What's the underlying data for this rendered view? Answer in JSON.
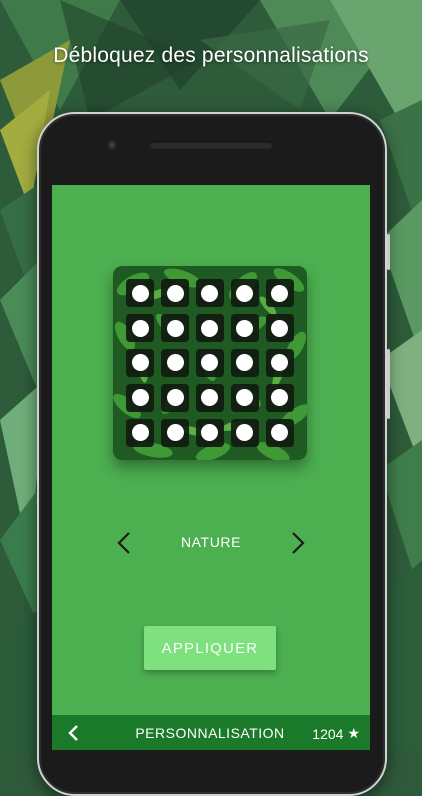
{
  "headline": "Débloquez des personnalisations",
  "customization": {
    "theme_name": "NATURE",
    "apply_label": "APPLIQUER",
    "grid": {
      "rows": 5,
      "cols": 5
    }
  },
  "bottom_bar": {
    "title": "PERSONNALISATION",
    "star_count": "1204",
    "star_icon": "★"
  },
  "colors": {
    "screen_bg": "#4caf50",
    "button_bg": "#7ee07f",
    "bottom_bar_bg": "#1b7a2a"
  }
}
